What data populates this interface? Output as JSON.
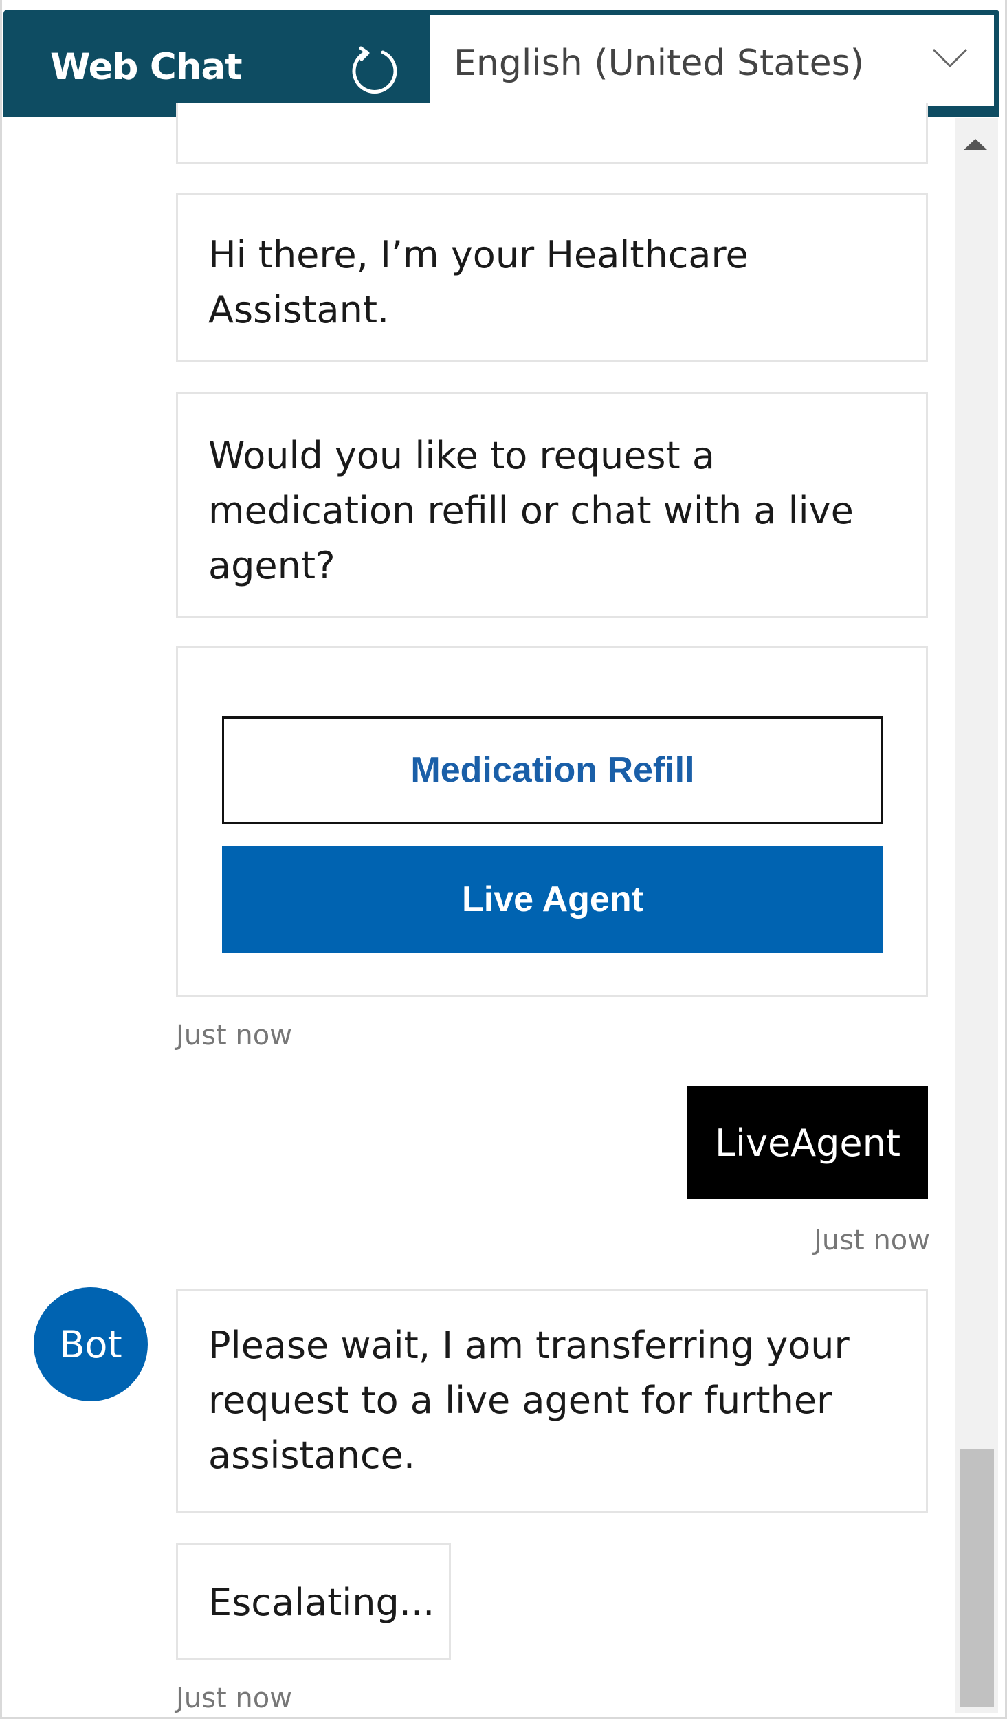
{
  "header": {
    "title": "Web Chat",
    "refresh_icon": "refresh-icon",
    "language_select": {
      "selected": "English (United States)",
      "icon": "chevron-down-icon"
    }
  },
  "colors": {
    "header_bg": "#0e4c62",
    "accent": "#0063b1",
    "user_bubble_bg": "#000000",
    "link_text": "#1a5fa8"
  },
  "messages": {
    "bot_greeting": "Hi there, I’m your Healthcare Assistant.",
    "bot_question": "Would you like to request a medication refill or chat with a live agent?",
    "actions": {
      "medication_refill": "Medication Refill",
      "live_agent": "Live Agent"
    },
    "timestamp_1": "Just now",
    "user_reply": "LiveAgent",
    "timestamp_2": "Just now",
    "bot_avatar": "Bot",
    "bot_transfer": "Please wait, I am transferring your request to a live agent for further assistance.",
    "bot_escalating": "Escalating...",
    "timestamp_3": "Just now"
  },
  "scrollbar": {
    "up_icon": "scroll-up-arrow-icon"
  }
}
